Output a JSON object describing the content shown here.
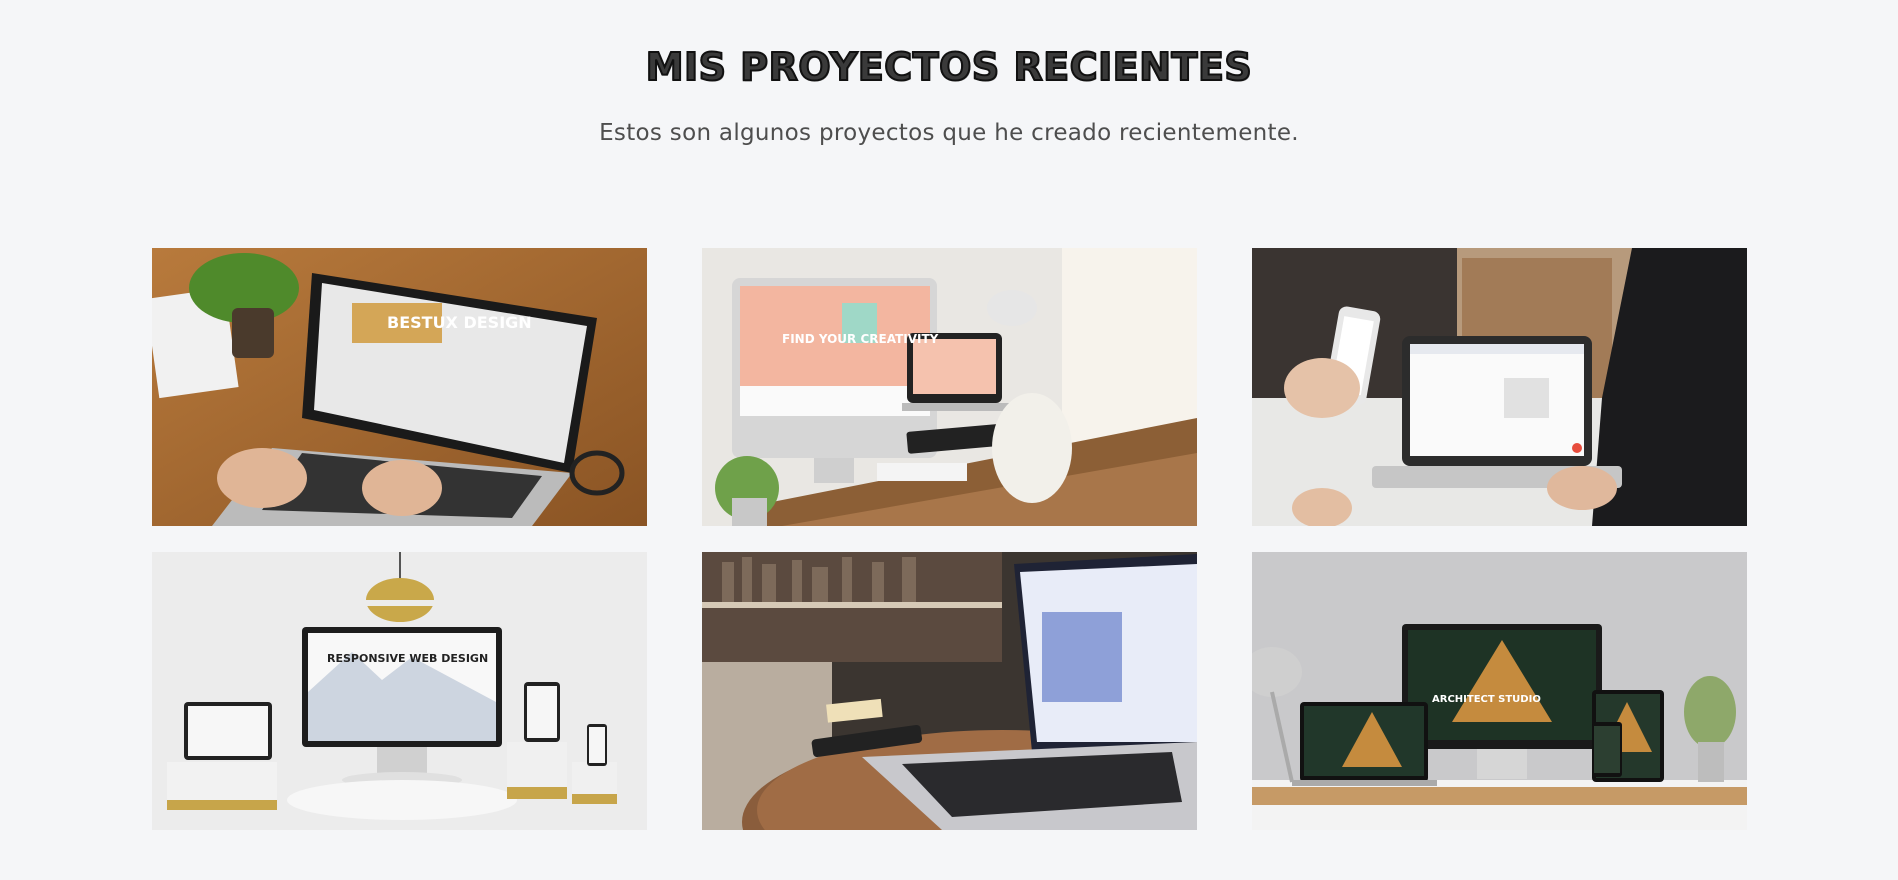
{
  "header": {
    "title": "MIS PROYECTOS RECIENTES",
    "subtitle": "Estos son algunos proyectos que he creado recientemente."
  },
  "projects": [
    {
      "label": "BESTUX DESIGN",
      "image": "laptop-on-wood-desk"
    },
    {
      "label": "FIND YOUR CREATIVITY",
      "image": "imac-and-devices-desk"
    },
    {
      "label": "",
      "image": "phone-and-laptop-app"
    },
    {
      "label": "RESPONSIVE WEB DESIGN",
      "image": "responsive-devices-pedestals"
    },
    {
      "label": "",
      "image": "macbook-on-round-table"
    },
    {
      "label": "ARCHITECT STUDIO",
      "image": "architect-studio-devices"
    }
  ]
}
